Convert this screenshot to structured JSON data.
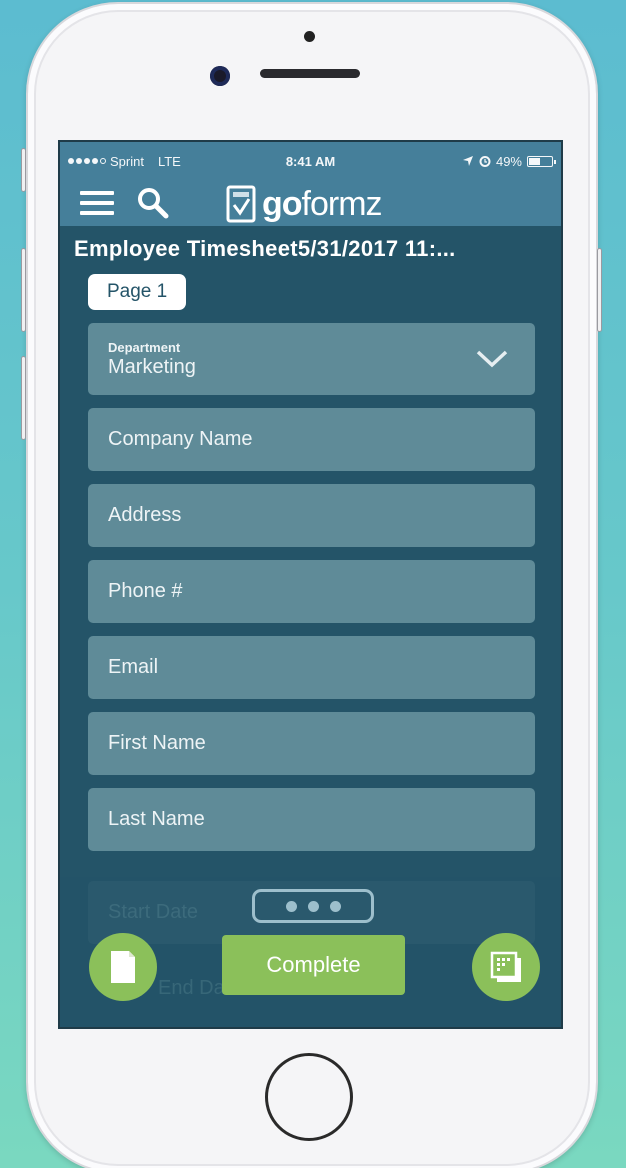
{
  "colors": {
    "background_top": "#5cbcd0",
    "background_bottom": "#7ad8c0",
    "app_header": "#457f9a",
    "app_body": "#245468",
    "field_bg": "#5f8b98",
    "accent_green": "#8bc05a"
  },
  "statusbar": {
    "carrier": "Sprint",
    "network": "LTE",
    "time": "8:41 AM",
    "battery": "49%",
    "battery_level": 0.49,
    "signal_bars": 4,
    "signal_max": 5
  },
  "navbar": {
    "menu_icon": "hamburger-menu-icon",
    "search_icon": "search-icon",
    "logo_icon": "form-check-icon",
    "logo_bold": "go",
    "logo_rest": "formz"
  },
  "form": {
    "title": "Employee Timesheet5/31/2017 11:...",
    "page_tab": "Page 1",
    "department": {
      "label": "Department",
      "value": "Marketing"
    },
    "fields": [
      {
        "placeholder": "Company Name"
      },
      {
        "placeholder": "Address"
      },
      {
        "placeholder": "Phone #"
      },
      {
        "placeholder": "Email"
      },
      {
        "placeholder": "First Name"
      },
      {
        "placeholder": "Last Name"
      }
    ],
    "obscured_fields": [
      {
        "placeholder": "Start Date"
      },
      {
        "placeholder": "End Date"
      }
    ]
  },
  "toolbar": {
    "more_icon": "more-dots-icon",
    "complete_label": "Complete",
    "left_icon": "document-icon",
    "right_icon": "pages-grid-icon"
  }
}
